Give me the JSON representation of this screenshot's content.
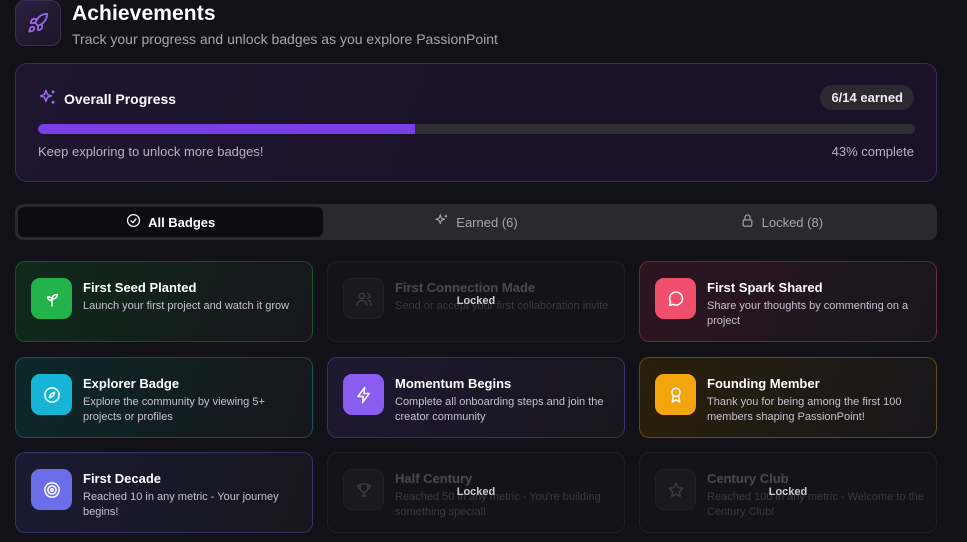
{
  "header": {
    "title": "Achievements",
    "subtitle": "Track your progress and unlock badges as you explore PassionPoint",
    "logo_icon": "rocket-icon"
  },
  "progress": {
    "title": "Overall Progress",
    "earned_badge": "6/14 earned",
    "percent_fraction": 0.43,
    "message": "Keep exploring to unlock more badges!",
    "percent_label": "43% complete",
    "accent": "#7a3ee6"
  },
  "tabs": [
    {
      "label": "All Badges",
      "icon": "check-circle-icon",
      "active": true
    },
    {
      "label": "Earned (6)",
      "icon": "sparkles-icon",
      "active": false
    },
    {
      "label": "Locked (8)",
      "icon": "lock-icon",
      "active": false
    }
  ],
  "badges": [
    {
      "title": "First Seed Planted",
      "desc": "Launch your first project and watch it grow",
      "icon": "sprout-icon",
      "locked": false,
      "color": "#22b34a",
      "tint": "#0f2a1a"
    },
    {
      "title": "First Connection Made",
      "desc": "Send or accept your first collaboration invite",
      "icon": "users-icon",
      "locked": true,
      "lock_text": "Locked"
    },
    {
      "title": "First Spark Shared",
      "desc": "Share your thoughts by commenting on a project",
      "icon": "message-circle-icon",
      "locked": false,
      "color": "#f0506e",
      "tint": "#2e1520"
    },
    {
      "title": "Explorer Badge",
      "desc": "Explore the community by viewing 5+ projects or profiles",
      "icon": "compass-icon",
      "locked": false,
      "color": "#16b5d6",
      "tint": "#0c2729"
    },
    {
      "title": "Momentum Begins",
      "desc": "Complete all onboarding steps and join the creator community",
      "icon": "zap-icon",
      "locked": false,
      "color": "#8a5cf0",
      "tint": "#1e1832"
    },
    {
      "title": "Founding Member",
      "desc": "Thank you for being among the first 100 members shaping PassionPoint!",
      "icon": "award-icon",
      "locked": false,
      "color": "#f2a50c",
      "tint": "#2a1f0a"
    },
    {
      "title": "First Decade",
      "desc": "Reached 10 in any metric - Your journey begins!",
      "icon": "target-icon",
      "locked": false,
      "color": "#6b6ee8",
      "tint": "#1b1a33"
    },
    {
      "title": "Half Century",
      "desc": "Reached 50 in any metric - You're building something special!",
      "icon": "trophy-icon",
      "locked": true,
      "lock_text": "Locked"
    },
    {
      "title": "Century Club",
      "desc": "Reached 100 in any metric - Welcome to the Century Club!",
      "icon": "star-icon",
      "locked": true,
      "lock_text": "Locked"
    }
  ]
}
